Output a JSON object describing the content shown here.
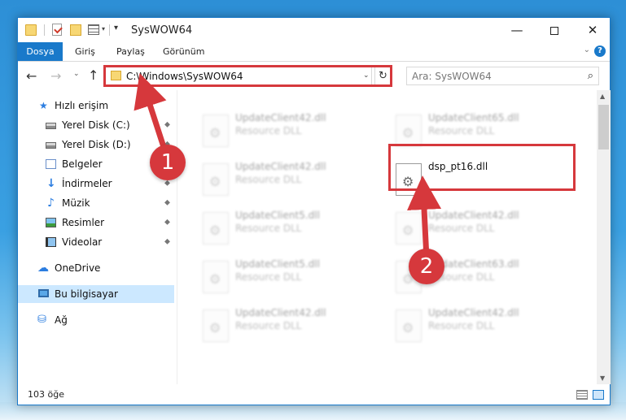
{
  "window": {
    "title": "SysWOW64",
    "minimize": "—",
    "close": "✕"
  },
  "ribbon": {
    "tabs": [
      "Dosya",
      "Giriş",
      "Paylaş",
      "Görünüm"
    ],
    "chevron": "⌄",
    "help": "?"
  },
  "nav": {
    "back": "←",
    "forward": "→",
    "recent": "⌄",
    "up": "↑",
    "address": "C:\\Windows\\SysWOW64",
    "address_dropdown": "⌄",
    "refresh": "↻",
    "search_placeholder": "Ara: SysWOW64",
    "search_icon": "⌕"
  },
  "sidebar": {
    "items": [
      {
        "label": "Hızlı erişim",
        "icon": "star-icon",
        "glyph": "★"
      },
      {
        "label": "Yerel Disk (C:)",
        "icon": "disk-icon",
        "pinned": true
      },
      {
        "label": "Yerel Disk (D:)",
        "icon": "disk-icon",
        "pinned": true
      },
      {
        "label": "Belgeler",
        "icon": "document-icon",
        "pinned": true
      },
      {
        "label": "İndirmeler",
        "icon": "download-icon",
        "glyph": "↓",
        "pinned": true
      },
      {
        "label": "Müzik",
        "icon": "music-icon",
        "glyph": "♪",
        "pinned": true
      },
      {
        "label": "Resimler",
        "icon": "picture-icon",
        "pinned": true
      },
      {
        "label": "Videolar",
        "icon": "video-icon",
        "pinned": true
      },
      {
        "label": "OneDrive",
        "icon": "cloud-icon",
        "glyph": "☁"
      },
      {
        "label": "Bu bilgisayar",
        "icon": "computer-icon",
        "selected": true
      },
      {
        "label": "Ağ",
        "icon": "network-icon",
        "glyph": "⛁"
      }
    ],
    "pin_glyph": "📌"
  },
  "files": [
    {
      "name": "UpdateClient42.dll",
      "desc": "Resource DLL",
      "blurred": true
    },
    {
      "name": "UpdateClient65.dll",
      "desc": "Resource DLL",
      "blurred": true
    },
    {
      "name": "UpdateClient42.dll",
      "desc": "Resource DLL",
      "blurred": true
    },
    {
      "name": "dsp_pt16.dll",
      "desc": "",
      "blurred": false
    },
    {
      "name": "UpdateClient5.dll",
      "desc": "Resource DLL",
      "blurred": true
    },
    {
      "name": "UpdateClient42.dll",
      "desc": "Resource DLL",
      "blurred": true
    },
    {
      "name": "UpdateClient5.dll",
      "desc": "Resource DLL",
      "blurred": true
    },
    {
      "name": "UpdateClient63.dll",
      "desc": "Resource DLL",
      "blurred": true
    },
    {
      "name": "UpdateClient42.dll",
      "desc": "Resource DLL",
      "blurred": true
    },
    {
      "name": "UpdateClient42.dll",
      "desc": "Resource DLL",
      "blurred": true
    }
  ],
  "status": {
    "item_count": "103 öğe"
  },
  "callouts": {
    "one": "1",
    "two": "2"
  },
  "colors": {
    "accent": "#1979ca",
    "highlight": "#d6383c",
    "selected": "#cce8ff"
  }
}
